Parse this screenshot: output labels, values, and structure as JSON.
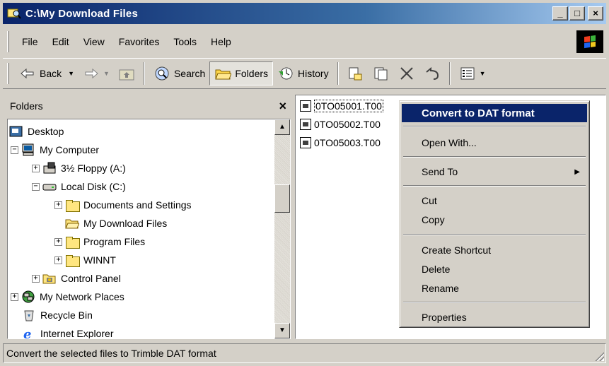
{
  "window": {
    "title": "C:\\My Download Files",
    "controls": [
      "_",
      "□",
      "×"
    ]
  },
  "menubar": {
    "items": [
      "File",
      "Edit",
      "View",
      "Favorites",
      "Tools",
      "Help"
    ]
  },
  "toolbar": {
    "back_label": "Back",
    "search_label": "Search",
    "folders_label": "Folders",
    "history_label": "History"
  },
  "folders_pane": {
    "title": "Folders",
    "close_glyph": "×",
    "tree": [
      {
        "label": "Desktop",
        "icon": "desktop-icon",
        "expander": ""
      },
      {
        "label": "My Computer",
        "icon": "computer-icon",
        "expander": "−"
      },
      {
        "label": "3½ Floppy (A:)",
        "icon": "floppy-icon",
        "expander": "+"
      },
      {
        "label": "Local Disk (C:)",
        "icon": "disk-icon",
        "expander": "−"
      },
      {
        "label": "Documents and Settings",
        "icon": "folder-icon",
        "expander": "+"
      },
      {
        "label": "My Download Files",
        "icon": "open-folder-icon",
        "expander": ""
      },
      {
        "label": "Program Files",
        "icon": "folder-icon",
        "expander": "+"
      },
      {
        "label": "WINNT",
        "icon": "folder-icon",
        "expander": "+"
      },
      {
        "label": "Control Panel",
        "icon": "control-panel-icon",
        "expander": "+"
      },
      {
        "label": "My Network Places",
        "icon": "network-icon",
        "expander": "+"
      },
      {
        "label": "Recycle Bin",
        "icon": "recycle-bin-icon",
        "expander": ""
      },
      {
        "label": "Internet Explorer",
        "icon": "ie-icon",
        "expander": ""
      }
    ]
  },
  "files": [
    {
      "name": "0TO05001.T00",
      "selected": true
    },
    {
      "name": "0TO05002.T00",
      "selected": false
    },
    {
      "name": "0TO05003.T00",
      "selected": false
    }
  ],
  "context_menu": {
    "items": [
      {
        "label": "Convert to DAT format",
        "highlight": true
      },
      {
        "label": "Open With..."
      },
      {
        "label": "Send To",
        "submenu": true
      },
      {
        "label": "Cut"
      },
      {
        "label": "Copy"
      },
      {
        "label": "Create Shortcut"
      },
      {
        "label": "Delete"
      },
      {
        "label": "Rename"
      },
      {
        "label": "Properties"
      }
    ]
  },
  "statusbar": {
    "text": "Convert the selected files to Trimble DAT format"
  },
  "colors": {
    "title_active": "#0a246a",
    "face": "#d4d0c8",
    "highlight": "#0a246a"
  }
}
